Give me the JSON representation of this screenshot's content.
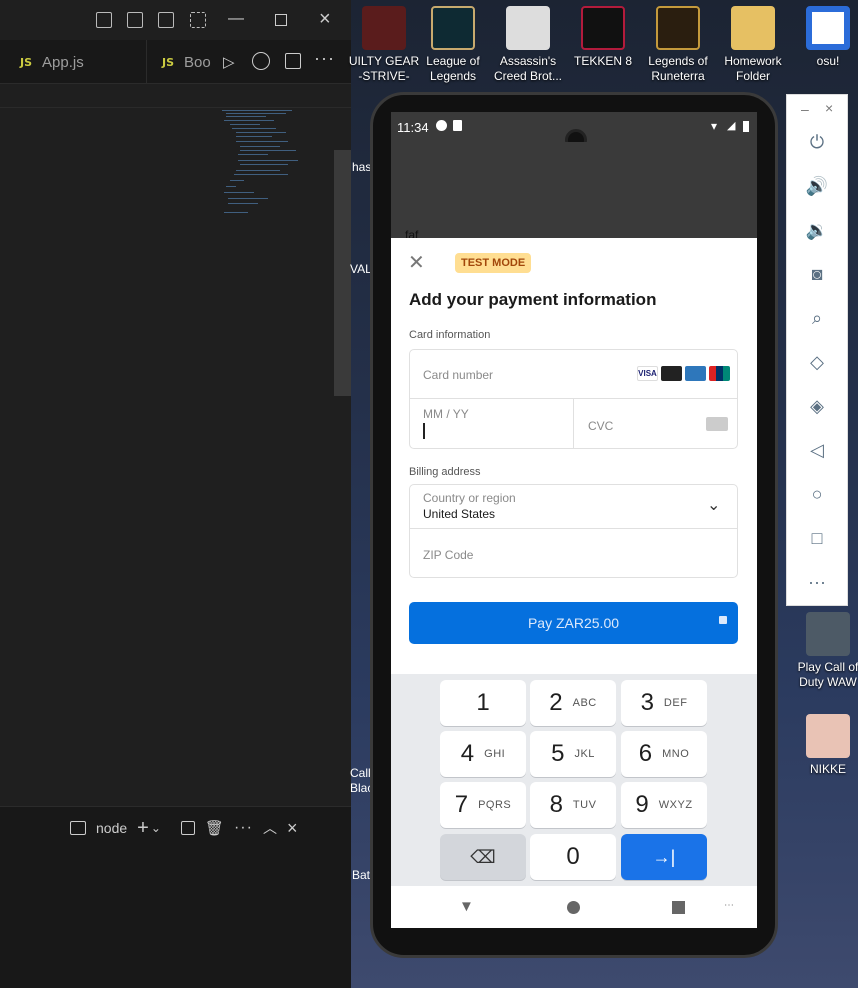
{
  "vscode": {
    "tabs": [
      {
        "badge": "JS",
        "label": "App.js"
      },
      {
        "badge": "JS",
        "label": "Boo"
      }
    ],
    "terminal": {
      "name": "node"
    },
    "colors": {
      "jsbadge": "#cbcb41",
      "bg": "#1f1f1f"
    }
  },
  "desktop": {
    "icons": [
      {
        "label": "UILTY GEAR -STRIVE-",
        "icon": "game-icon"
      },
      {
        "label": "League of Legends",
        "icon": "league-icon"
      },
      {
        "label": "Assassin's Creed Brot...",
        "icon": "assassins-icon"
      },
      {
        "label": "TEKKEN 8",
        "icon": "tekken-icon"
      },
      {
        "label": "Legends of Runeterra",
        "icon": "runeterra-icon"
      },
      {
        "label": "Homework Folder",
        "icon": "folder-icon"
      },
      {
        "label": "osu!",
        "icon": "osu-icon"
      },
      {
        "label": "Play Call of Duty WAW",
        "icon": "cod-icon"
      },
      {
        "label": "NIKKE",
        "icon": "nikke-icon"
      },
      {
        "label": "has",
        "icon": "partial-icon"
      },
      {
        "label": "VALO",
        "icon": "valorant-icon"
      },
      {
        "label": "Call Black",
        "icon": "cod-black-icon"
      },
      {
        "label": "Bat",
        "icon": "battle-icon"
      }
    ]
  },
  "phone": {
    "status": {
      "time": "11:34"
    },
    "behind_text": "faf",
    "sheet": {
      "badge": "TEST MODE",
      "title": "Add your payment information",
      "card_section": "Card information",
      "card_number_placeholder": "Card number",
      "expiry_placeholder": "MM / YY",
      "cvc_placeholder": "CVC",
      "billing_section": "Billing address",
      "country_label": "Country or region",
      "country_value": "United States",
      "zip_placeholder": "ZIP Code",
      "pay_label": "Pay ZAR25.00",
      "accent": "#0570de"
    },
    "keyboard": {
      "keys": [
        {
          "n": "1",
          "l": ""
        },
        {
          "n": "2",
          "l": "ABC"
        },
        {
          "n": "3",
          "l": "DEF"
        },
        {
          "n": "4",
          "l": "GHI"
        },
        {
          "n": "5",
          "l": "JKL"
        },
        {
          "n": "6",
          "l": "MNO"
        },
        {
          "n": "7",
          "l": "PQRS"
        },
        {
          "n": "8",
          "l": "TUV"
        },
        {
          "n": "9",
          "l": "WXYZ"
        },
        {
          "n": "0",
          "l": ""
        }
      ]
    }
  }
}
